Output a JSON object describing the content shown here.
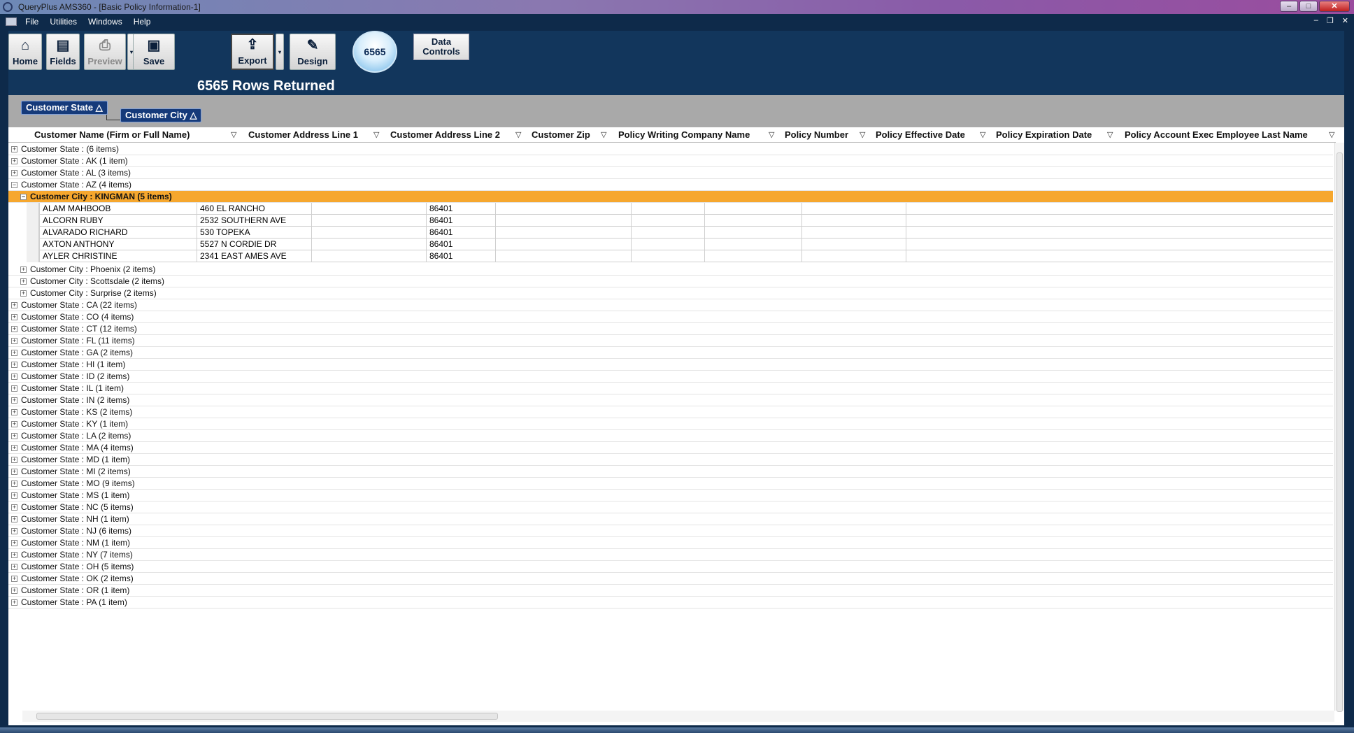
{
  "window": {
    "title": "QueryPlus AMS360 - [Basic Policy Information-1]"
  },
  "menu": [
    "File",
    "Utilities",
    "Windows",
    "Help"
  ],
  "toolbar": {
    "home": "Home",
    "fields": "Fields",
    "preview": "Preview",
    "save": "Save",
    "export": "Export",
    "design": "Design",
    "count_badge": "6565",
    "data_controls_line1": "Data",
    "data_controls_line2": "Controls",
    "rows_returned": "6565 Rows Returned"
  },
  "group_by": [
    {
      "label": "Customer State"
    },
    {
      "label": "Customer City"
    }
  ],
  "columns": [
    "Customer Name (Firm or Full Name)",
    "Customer Address Line 1",
    "Customer Address Line 2",
    "Customer Zip",
    "Policy Writing Company Name",
    "Policy Number",
    "Policy Effective Date",
    "Policy Expiration Date",
    "Policy Account Exec Employee Last Name"
  ],
  "groups_before": [
    "Customer State :  (6 items)",
    "Customer State : AK (1 item)",
    "Customer State : AL (3 items)",
    "Customer State : AZ (4 items)"
  ],
  "expanded_city": "Customer City : KINGMAN (5 items)",
  "detail_rows": [
    {
      "name": "ALAM MAHBOOB",
      "addr1": "460 EL RANCHO",
      "addr2": "",
      "zip": "86401"
    },
    {
      "name": "ALCORN RUBY",
      "addr1": "2532 SOUTHERN AVE",
      "addr2": "",
      "zip": "86401"
    },
    {
      "name": "ALVARADO RICHARD",
      "addr1": "530 TOPEKA",
      "addr2": "",
      "zip": "86401"
    },
    {
      "name": "AXTON ANTHONY",
      "addr1": "5527 N CORDIE DR",
      "addr2": "",
      "zip": "86401"
    },
    {
      "name": "AYLER CHRISTINE",
      "addr1": "2341 EAST AMES AVE",
      "addr2": "",
      "zip": "86401"
    }
  ],
  "other_cities": [
    "Customer City : Phoenix (2 items)",
    "Customer City : Scottsdale (2 items)",
    "Customer City : Surprise (2 items)"
  ],
  "groups_after": [
    "Customer State : CA (22 items)",
    "Customer State : CO (4 items)",
    "Customer State : CT (12 items)",
    "Customer State : FL (11 items)",
    "Customer State : GA (2 items)",
    "Customer State : HI (1 item)",
    "Customer State : ID (2 items)",
    "Customer State : IL (1 item)",
    "Customer State : IN (2 items)",
    "Customer State : KS (2 items)",
    "Customer State : KY (1 item)",
    "Customer State : LA (2 items)",
    "Customer State : MA (4 items)",
    "Customer State : MD (1 item)",
    "Customer State : MI (2 items)",
    "Customer State : MO (9 items)",
    "Customer State : MS (1 item)",
    "Customer State : NC (5 items)",
    "Customer State : NH (1 item)",
    "Customer State : NJ (6 items)",
    "Customer State : NM (1 item)",
    "Customer State : NY (7 items)",
    "Customer State : OH (5 items)",
    "Customer State : OK (2 items)",
    "Customer State : OR (1 item)",
    "Customer State : PA (1 item)"
  ],
  "colors": {
    "accent_row": "#f6a72e",
    "chrome": "#0e2a4a",
    "group_chip": "#153a7a"
  }
}
